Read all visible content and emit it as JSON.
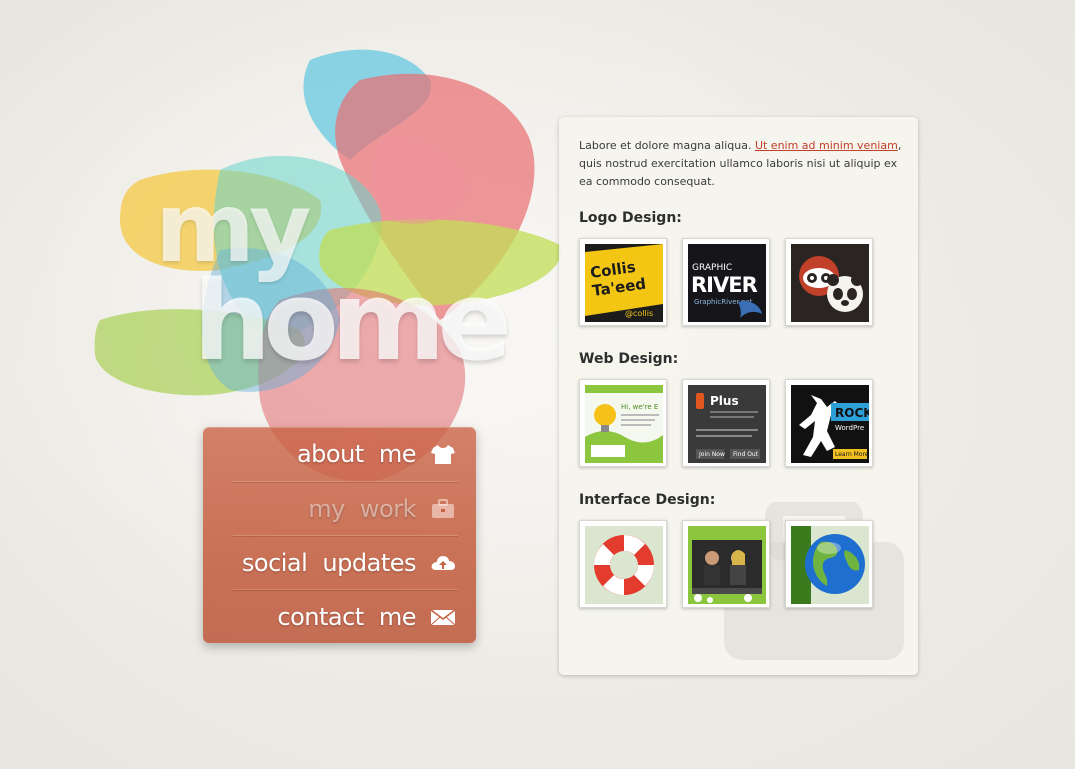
{
  "logo": {
    "line1": "my",
    "line2": "home"
  },
  "nav": {
    "items": [
      {
        "label": "about me",
        "icon": "tshirt-icon",
        "active": false
      },
      {
        "label": "my work",
        "icon": "briefcase-icon",
        "active": true
      },
      {
        "label": "social updates",
        "icon": "cloud-upload-icon",
        "active": false
      },
      {
        "label": "contact me",
        "icon": "envelope-icon",
        "active": false
      }
    ]
  },
  "panel": {
    "intro_before": "Labore et dolore magna aliqua. ",
    "intro_link": "Ut enim ad minim veniam",
    "intro_after": ", quis nostrud exercitation ullamco laboris nisi ut aliquip ex ea commodo consequat.",
    "sections": [
      {
        "title": "Logo Design:",
        "thumbs": [
          {
            "icon": "collis-taeed-logo-thumbnail",
            "text1": "Collis",
            "text2": "Ta'eed",
            "text3": "@collis"
          },
          {
            "icon": "graphicriver-logo-thumbnail",
            "text1": "GRAPHIC",
            "text2": "RIVER",
            "text3": "GraphicRiver.net"
          },
          {
            "icon": "raccoon-panda-logo-thumbnail"
          }
        ]
      },
      {
        "title": "Web Design:",
        "thumbs": [
          {
            "icon": "lightbulb-website-thumbnail",
            "text1": "Hi, we're E"
          },
          {
            "icon": "plus-website-thumbnail",
            "text1": "Plus",
            "text2": "Join Now",
            "text3": "Find Out"
          },
          {
            "icon": "rock-wordpress-thumbnail",
            "text1": "ROCK",
            "text2": "WordPre",
            "text3": "Learn More"
          }
        ]
      },
      {
        "title": "Interface Design:",
        "thumbs": [
          {
            "icon": "lifebuoy-icon-thumbnail"
          },
          {
            "icon": "video-player-interface-thumbnail"
          },
          {
            "icon": "globe-icon-thumbnail"
          }
        ]
      }
    ]
  },
  "colors": {
    "background": "#f1efe9",
    "nav_fill": "#c66243",
    "link": "#c1402a",
    "heading": "#2e2e2e",
    "body_text": "#3b3b3b"
  }
}
